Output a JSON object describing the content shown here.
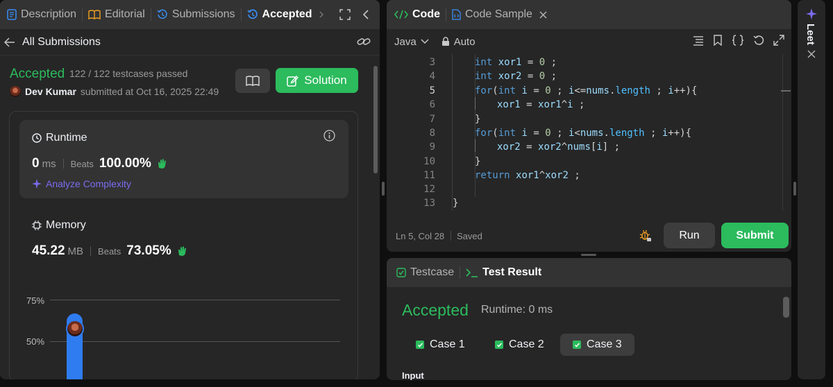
{
  "left": {
    "tabs": [
      {
        "label": "Description",
        "icon": "description-icon"
      },
      {
        "label": "Editorial",
        "icon": "book-icon"
      },
      {
        "label": "Submissions",
        "icon": "history-icon"
      },
      {
        "label": "Accepted",
        "icon": "accepted-history-icon"
      }
    ],
    "back_label": "All Submissions",
    "status": "Accepted",
    "testcases": "122 / 122 testcases passed",
    "submitter": {
      "name": "Dev Kumar",
      "text": "submitted at Oct 16, 2025 22:49"
    },
    "solution_label": "Solution",
    "runtime": {
      "title": "Runtime",
      "value": "0",
      "unit": "ms",
      "beats_label": "Beats",
      "beats": "100.00%"
    },
    "analyze_label": "Analyze Complexity",
    "memory": {
      "title": "Memory",
      "value": "45.22",
      "unit": "MB",
      "beats_label": "Beats",
      "beats": "73.05%"
    },
    "chart": {
      "ticks": [
        "75%",
        "50%"
      ],
      "bar_percent": 66
    }
  },
  "code": {
    "tabs": [
      {
        "label": "Code"
      },
      {
        "label": "Code Sample"
      }
    ],
    "language": "Java",
    "mode": "Auto",
    "lines": [
      {
        "n": "3",
        "text": "int xor1 = 0 ;"
      },
      {
        "n": "4",
        "text": "int xor2 = 0 ;"
      },
      {
        "n": "5",
        "text": "for(int i = 0 ; i<=nums.length ; i++){"
      },
      {
        "n": "6",
        "text": "xor1 = xor1^i ;"
      },
      {
        "n": "7",
        "text": "}"
      },
      {
        "n": "8",
        "text": "for(int i = 0 ; i<nums.length ; i++){"
      },
      {
        "n": "9",
        "text": "xor2 = xor2^nums[i] ;"
      },
      {
        "n": "10",
        "text": "}"
      },
      {
        "n": "11",
        "text": "return xor1^xor2 ;"
      },
      {
        "n": "12",
        "text": ""
      },
      {
        "n": "13",
        "text": "}"
      }
    ],
    "cursor": "Ln 5, Col 28",
    "saved": "Saved",
    "run_label": "Run",
    "submit_label": "Submit"
  },
  "result": {
    "tabs": [
      {
        "label": "Testcase"
      },
      {
        "label": "Test Result"
      }
    ],
    "status": "Accepted",
    "runtime": "Runtime: 0 ms",
    "cases": [
      "Case 1",
      "Case 2",
      "Case 3"
    ],
    "input_label": "Input"
  },
  "rail": {
    "label": "Leet"
  },
  "colors": {
    "accent_green": "#2cbb5d",
    "tab_bar": "#333333",
    "panel": "#262626",
    "bar_blue": "#2f7cf0"
  }
}
